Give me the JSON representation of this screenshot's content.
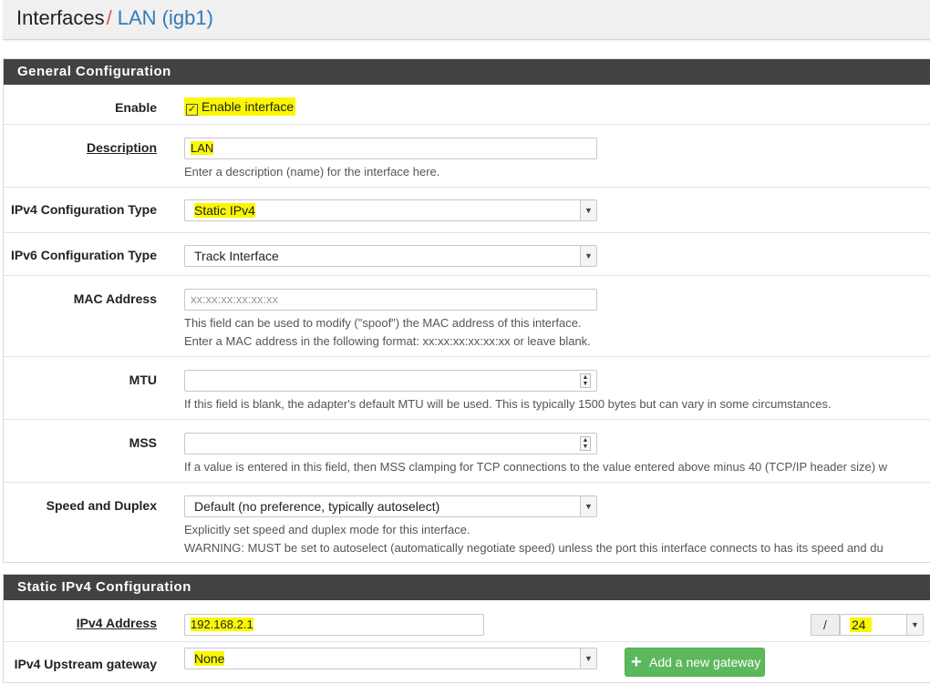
{
  "breadcrumb": {
    "parent": "Interfaces",
    "separator": "/",
    "current": "LAN (igb1)"
  },
  "general": {
    "heading": "General Configuration",
    "enable": {
      "label": "Enable",
      "checkbox_label": "Enable interface",
      "checked": true
    },
    "description": {
      "label": "Description",
      "value": "LAN",
      "help": "Enter a description (name) for the interface here."
    },
    "ipv4_type": {
      "label": "IPv4 Configuration Type",
      "value": "Static IPv4"
    },
    "ipv6_type": {
      "label": "IPv6 Configuration Type",
      "value": "Track Interface"
    },
    "mac": {
      "label": "MAC Address",
      "placeholder": "xx:xx:xx:xx:xx:xx",
      "help1": "This field can be used to modify (\"spoof\") the MAC address of this interface.",
      "help2": "Enter a MAC address in the following format: xx:xx:xx:xx:xx:xx or leave blank."
    },
    "mtu": {
      "label": "MTU",
      "value": "",
      "help": "If this field is blank, the adapter's default MTU will be used. This is typically 1500 bytes but can vary in some circumstances."
    },
    "mss": {
      "label": "MSS",
      "value": "",
      "help": "If a value is entered in this field, then MSS clamping for TCP connections to the value entered above minus 40 (TCP/IP header size) w"
    },
    "speed": {
      "label": "Speed and Duplex",
      "value": "Default (no preference, typically autoselect)",
      "help1": "Explicitly set speed and duplex mode for this interface.",
      "help2": "WARNING: MUST be set to autoselect (automatically negotiate speed) unless the port this interface connects to has its speed and du"
    }
  },
  "static_ipv4": {
    "heading": "Static IPv4 Configuration",
    "address": {
      "label": "IPv4 Address",
      "value": "192.168.2.1",
      "slash": "/",
      "cidr": "24"
    },
    "gateway": {
      "label": "IPv4 Upstream gateway",
      "value": "None",
      "add_button": "Add a new gateway"
    }
  },
  "icons": {
    "checkbox": "checkbox-checked-icon",
    "arrow": "chevron-down-icon",
    "spinner": "spinner-icon",
    "add": "plus-icon"
  },
  "colors": {
    "highlight": "#fbf703",
    "panel_heading": "#424242",
    "link": "#337ab7",
    "separator": "#d9534f",
    "success": "#5cb85c"
  }
}
